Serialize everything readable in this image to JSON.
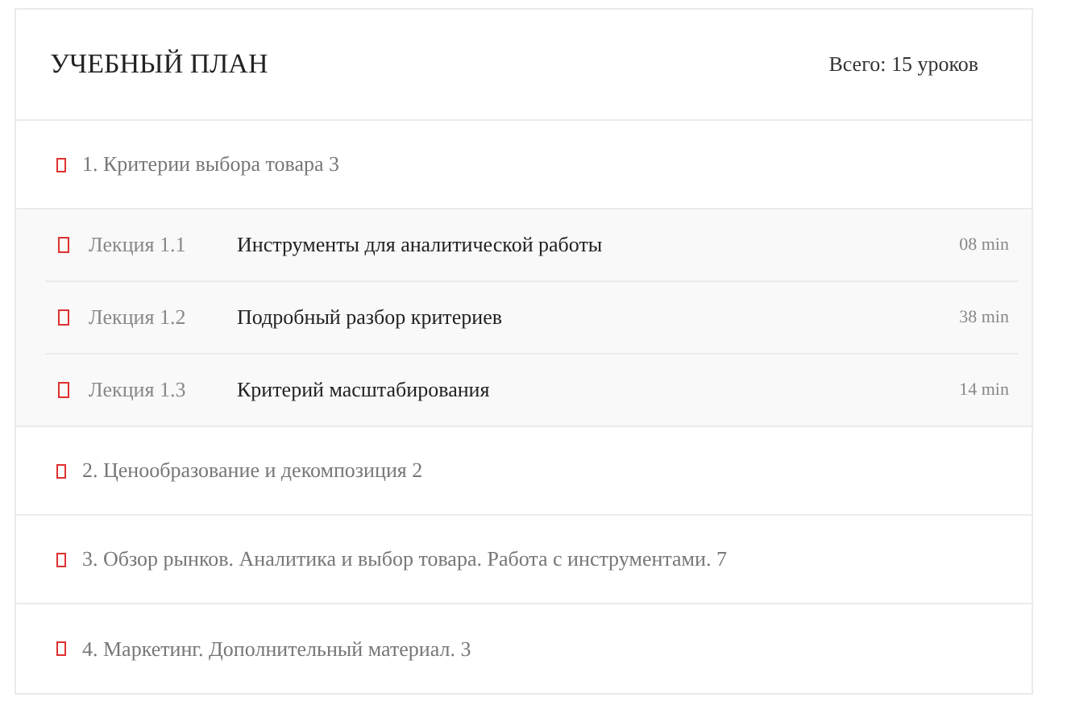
{
  "header": {
    "title": "УЧЕБНЫЙ ПЛАН",
    "total": "Всего: 15 уроков"
  },
  "sections": [
    {
      "title": "1. Критерии выбора товара 3",
      "lessons": [
        {
          "label": "Лекция 1.1",
          "title": "Инструменты для аналитической работы",
          "duration": "08 min"
        },
        {
          "label": "Лекция 1.2",
          "title": "Подробный разбор критериев",
          "duration": "38 min"
        },
        {
          "label": "Лекция 1.3",
          "title": "Критерий масштабирования",
          "duration": "14 min"
        }
      ]
    },
    {
      "title": "2. Ценообразование и декомпозиция 2"
    },
    {
      "title": "3. Обзор рынков. Аналитика и выбор товара. Работа с инструментами. 7"
    },
    {
      "title": "4. Маркетинг. Дополнительный материал. 3"
    }
  ]
}
